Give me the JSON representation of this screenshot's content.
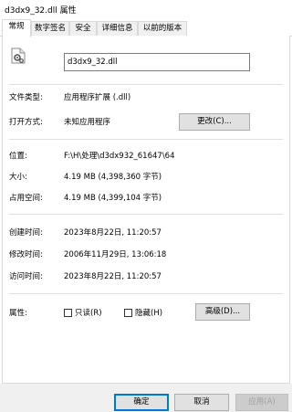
{
  "window": {
    "title": "d3dx9_32.dll 属性"
  },
  "tabs": [
    {
      "label": "常规"
    },
    {
      "label": "数字签名"
    },
    {
      "label": "安全"
    },
    {
      "label": "详细信息"
    },
    {
      "label": "以前的版本"
    }
  ],
  "general": {
    "file_name": "d3dx9_32.dll",
    "file_type_label": "文件类型:",
    "file_type_value": "应用程序扩展 (.dll)",
    "opens_with_label": "打开方式:",
    "opens_with_value": "未知应用程序",
    "change_button": "更改(C)...",
    "location_label": "位置:",
    "location_value": "F:\\H\\处理\\d3dx932_61647\\64",
    "size_label": "大小:",
    "size_value": "4.19 MB (4,398,360 字节)",
    "size_on_disk_label": "占用空间:",
    "size_on_disk_value": "4.19 MB (4,399,104 字节)",
    "created_label": "创建时间:",
    "created_value": "2023年8月22日, 11:20:57",
    "modified_label": "修改时间:",
    "modified_value": "2006年11月29日, 13:06:18",
    "accessed_label": "访问时间:",
    "accessed_value": "2023年8月22日, 11:20:57",
    "attributes_label": "属性:",
    "readonly_label": "只读(R)",
    "hidden_label": "隐藏(H)",
    "advanced_button": "高级(D)..."
  },
  "footer": {
    "ok": "确定",
    "cancel": "取消",
    "apply": "应用(A)"
  },
  "icons": {
    "file": "dll-file-gear-icon"
  },
  "colors": {
    "accent": "#0078d7",
    "button_bg": "#e1e1e1",
    "footer_bg": "#f0f0f0"
  }
}
